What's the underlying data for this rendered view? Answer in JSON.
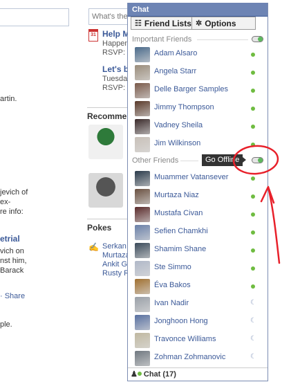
{
  "left_column": {
    "lines": [
      "artin.",
      "jevich of",
      "ex-",
      "re info:",
      "vich on",
      "nst him,",
      "Barack",
      "ple."
    ],
    "link": "etrial",
    "share_link": "· Share"
  },
  "middle": {
    "composer_placeholder": "What's the",
    "calendar_icon_text": "31",
    "event1": {
      "title": "Help M",
      "line1": "Happen",
      "line2": "RSVP: "
    },
    "event2": {
      "title": "Let's b",
      "line1": "Tuesda",
      "line2": "RSVP: "
    },
    "recommendations_header": "Recomme",
    "pokes_header": "Pokes",
    "pokes_names": [
      "Serkan",
      "Murtaza",
      "Ankit Gu",
      "Rusty R"
    ]
  },
  "chat": {
    "title": "Chat",
    "tab_friend_lists": "Friend Lists",
    "tab_options": "Options",
    "group_important": "Important Friends",
    "group_other": "Other Friends",
    "tooltip": "Go Offline",
    "footer_label": "Chat (17)",
    "important_friends": [
      {
        "name": "Adam Alsaro",
        "status": "online",
        "avatar": "#4a6a8a"
      },
      {
        "name": "Angela Starr",
        "status": "online",
        "avatar": "#9a8c7a"
      },
      {
        "name": "Delle Barger Samples",
        "status": "online",
        "avatar": "#7a5a4a"
      },
      {
        "name": "Jimmy Thompson",
        "status": "online",
        "avatar": "#5a3a2a"
      },
      {
        "name": "Vadney Sheila",
        "status": "online",
        "avatar": "#3a2a2a"
      },
      {
        "name": "Jim Wilkinson",
        "status": "online",
        "avatar": "#c8c0b8"
      }
    ],
    "other_friends": [
      {
        "name": "Muammer Vatansever",
        "status": "online",
        "avatar": "#2a3a4a"
      },
      {
        "name": "Murtaza Niaz",
        "status": "online",
        "avatar": "#6a5040"
      },
      {
        "name": "Mustafa Civan",
        "status": "online",
        "avatar": "#5a2a2a"
      },
      {
        "name": "Sefien Chamkhi",
        "status": "online",
        "avatar": "#6a80a8"
      },
      {
        "name": "Shamim Shane",
        "status": "online",
        "avatar": "#3a4a5a"
      },
      {
        "name": "Ste Simmo",
        "status": "online",
        "avatar": "#b0b8c8"
      },
      {
        "name": "Éva Bakos",
        "status": "online",
        "avatar": "#a07030"
      },
      {
        "name": "Ivan Nadir",
        "status": "idle",
        "avatar": "#9aa0a8"
      },
      {
        "name": "Jonghoon Hong",
        "status": "idle",
        "avatar": "#5870a0"
      },
      {
        "name": "Travonce Williams",
        "status": "idle",
        "avatar": "#c0b8a0"
      },
      {
        "name": "Zohman Zohmanovic",
        "status": "idle",
        "avatar": "#707880"
      }
    ]
  },
  "colors": {
    "header_blue": "#6d84b4",
    "link_blue": "#3b5998",
    "online_green": "#6fbc41",
    "annotation_red": "#e8202a"
  }
}
